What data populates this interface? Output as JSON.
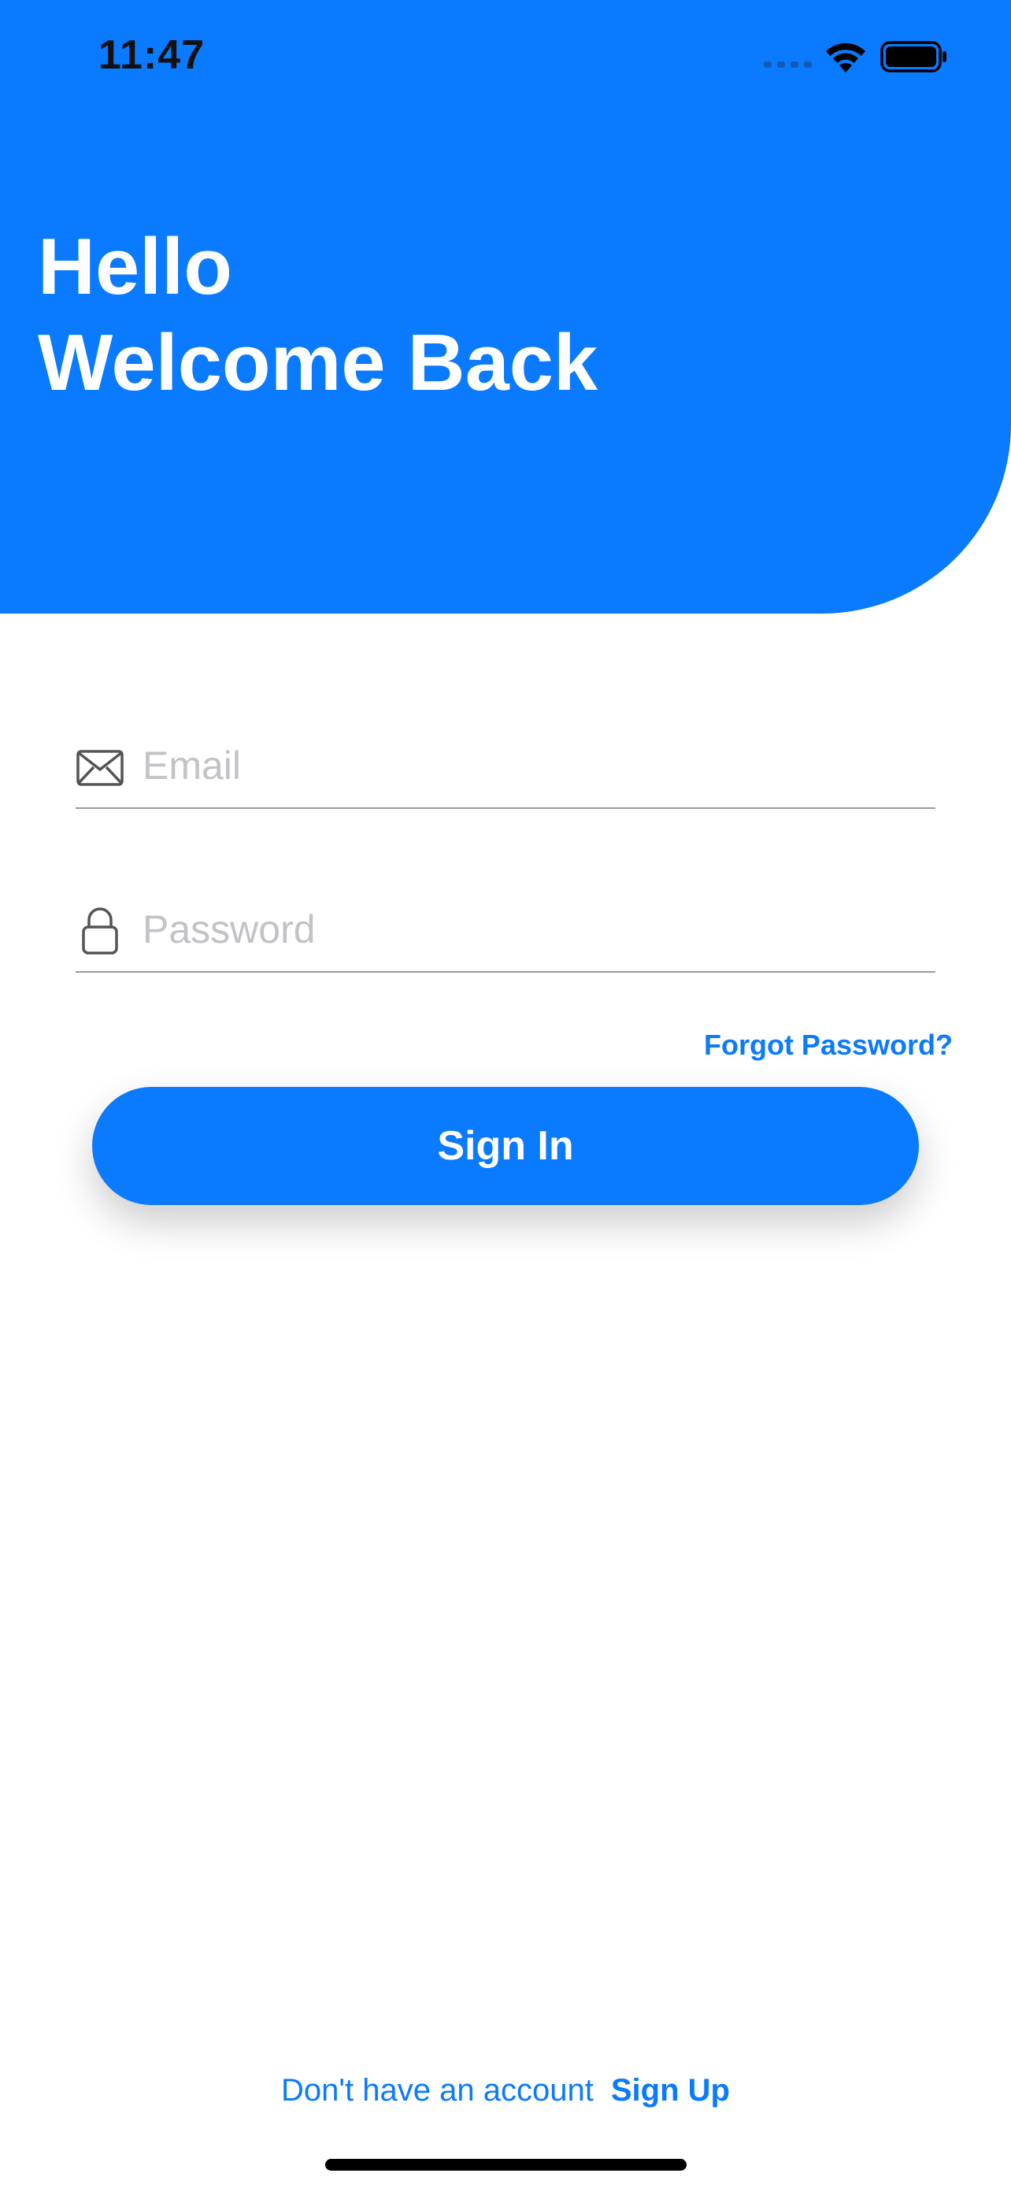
{
  "status_bar": {
    "time": "11:47"
  },
  "header": {
    "line1": "Hello",
    "line2": "Welcome Back",
    "background_color": "#0A7AFF"
  },
  "form": {
    "email": {
      "placeholder": "Email",
      "value": "",
      "icon": "envelope-icon"
    },
    "password": {
      "placeholder": "Password",
      "value": "",
      "icon": "lock-icon"
    },
    "forgot_label": "Forgot Password?",
    "signin_label": "Sign In"
  },
  "footer": {
    "prompt": "Don't have an account",
    "signup_label": "Sign Up"
  },
  "colors": {
    "accent": "#0A7AFF",
    "placeholder": "#c2c2c7",
    "divider": "#9a9a9a"
  }
}
